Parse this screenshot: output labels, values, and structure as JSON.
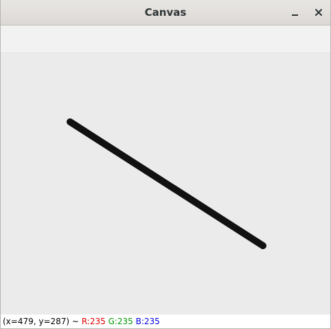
{
  "window": {
    "title": "Canvas"
  },
  "status": {
    "coords": "(x=479, y=287) ~",
    "r": "R:235",
    "g": "G:235",
    "b": "B:235"
  },
  "icons": {
    "minimize": "minimize-icon",
    "close": "close-icon"
  },
  "colors": {
    "canvas_bg": "#ebebeb",
    "line": "#111111",
    "r_text": "#e00000",
    "g_text": "#009900",
    "b_text": "#0000e0"
  }
}
